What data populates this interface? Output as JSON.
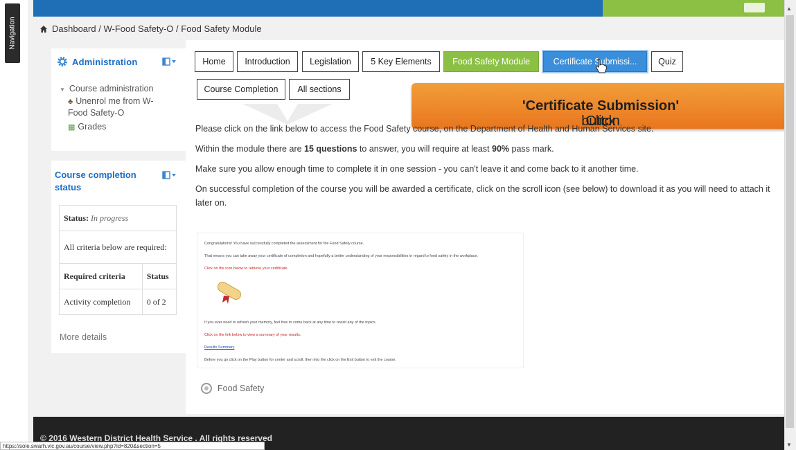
{
  "nav": {
    "label": "Navigation"
  },
  "breadcrumb": {
    "items": [
      "Dashboard",
      "W-Food Safety-O",
      "Food Safety Module"
    ],
    "separator": "/"
  },
  "admin_block": {
    "title": "Administration",
    "tree": {
      "course_admin": "Course administration",
      "unenrol": "Unenrol me from W-Food Safety-O",
      "grades": "Grades"
    }
  },
  "course_block": {
    "title": "Course completion status",
    "status_label": "Status:",
    "status_value": "In progress",
    "criteria_note": "All criteria below are required:",
    "col_criteria": "Required criteria",
    "col_status": "Status",
    "row_criteria": "Activity completion",
    "row_status": "0 of 2",
    "more_details": "More details"
  },
  "tabs": [
    {
      "label": "Home"
    },
    {
      "label": "Introduction"
    },
    {
      "label": "Legislation"
    },
    {
      "label": "5 Key Elements"
    },
    {
      "label": "Food Safety Module"
    },
    {
      "label": "Certificate Submissi..."
    },
    {
      "label": "Quiz"
    },
    {
      "label": "Course Completion"
    },
    {
      "label": "All sections"
    }
  ],
  "callout": {
    "prefix": "Click ",
    "bold": "'Certificate Submission'",
    "suffix": " button"
  },
  "intro": {
    "p1": "Please click on the link below to access the Food Safety course, on the Department of Health and Human Services site.",
    "p2_pre": "Within the module there are ",
    "p2_b1": "15 questions",
    "p2_mid": " to answer, you will require at least ",
    "p2_b2": "90%",
    "p2_post": " pass mark.",
    "p3": "Make sure you allow enough time to complete it in one session - you can't leave it and come back to it another time.",
    "p4": "On successful completion of the course you will be awarded a certificate, click on the scroll icon (see below) to download it as you will need to attach it later on."
  },
  "cert_preview": {
    "l1": "Congratulations! You have successfully completed the assessment for the Food Safety course.",
    "l2": "That means you can take away your certificate of completion and hopefully a better understanding of your responsibilities in regard to food safety in the workplace.",
    "l3": "Click on the icon below to retrieve your certificate.",
    "l4": "If you ever need to refresh your memory, feel free to come back at any time to revisit any of the topics.",
    "l5": "Click on the link below to view a summary of your results.",
    "l6": "Results Summary",
    "l7": "Before you go click on the Play button for center and scroll, then into the click on the Exit button to exit the course."
  },
  "food_safety_link": "Food Safety",
  "footer": {
    "text": "© 2016 Western District Health Service . All rights reserved"
  },
  "status_url": "https://sole.swarh.vic.gov.au/course/view.php?id=820&section=5",
  "colors": {
    "green": "#8cc044",
    "blue": "#3b8ed9",
    "orange": "#e9761e",
    "link": "#1b6ec2"
  }
}
